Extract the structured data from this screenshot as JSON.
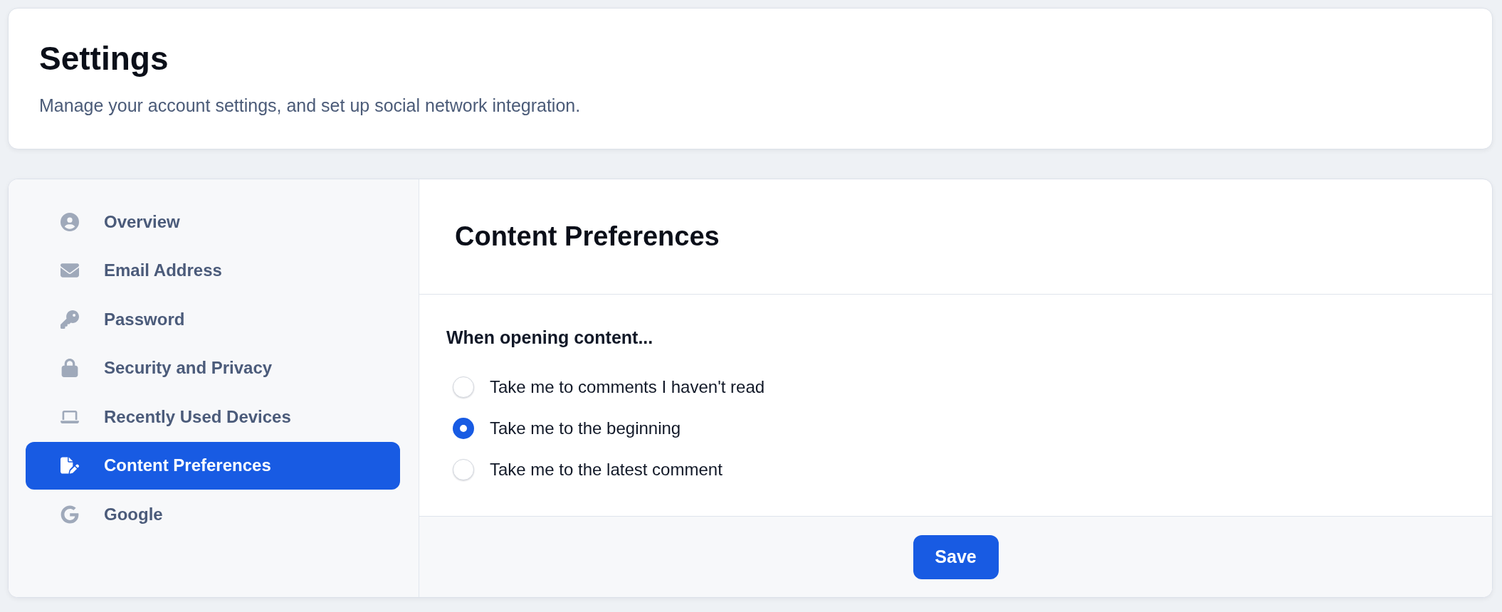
{
  "header": {
    "title": "Settings",
    "subtitle": "Manage your account settings, and set up social network integration."
  },
  "sidebar": {
    "items": [
      {
        "label": "Overview",
        "selected": false
      },
      {
        "label": "Email Address",
        "selected": false
      },
      {
        "label": "Password",
        "selected": false
      },
      {
        "label": "Security and Privacy",
        "selected": false
      },
      {
        "label": "Recently Used Devices",
        "selected": false
      },
      {
        "label": "Content Preferences",
        "selected": true
      },
      {
        "label": "Google",
        "selected": false
      }
    ]
  },
  "panel": {
    "title": "Content Preferences",
    "question": "When opening content...",
    "options": [
      {
        "label": "Take me to comments I haven't read",
        "selected": false
      },
      {
        "label": "Take me to the beginning",
        "selected": true
      },
      {
        "label": "Take me to the latest comment",
        "selected": false
      }
    ],
    "save_button": "Save"
  }
}
